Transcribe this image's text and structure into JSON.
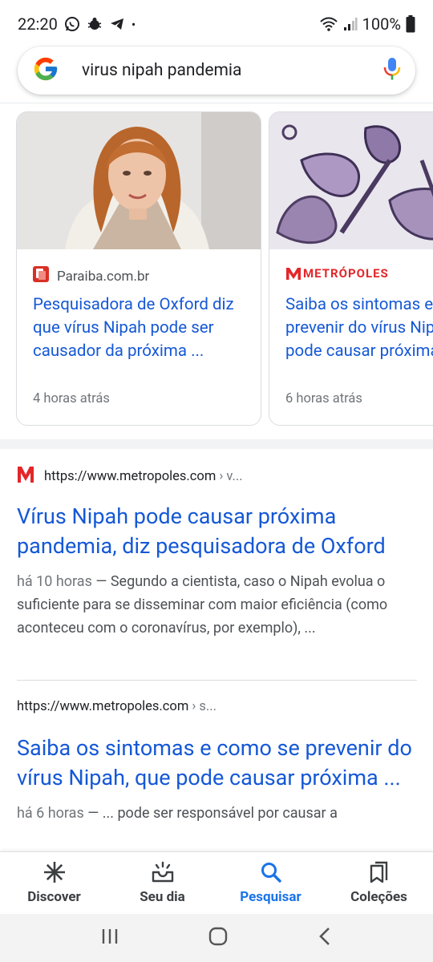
{
  "status_bar": {
    "time": "22:20",
    "dot": "•",
    "battery": "100%"
  },
  "search": {
    "query": "virus nipah pandemia"
  },
  "top_stories": [
    {
      "source": "Paraiba.com.br",
      "title": "Pesquisadora de Oxford diz que vírus Nipah pode ser causador da próxima ...",
      "time": "4 horas atrás"
    },
    {
      "source_logo_text": "METRÓPOLES",
      "title": "Saiba os sintomas e como se prevenir do vírus Nipah, que pode causar próxima...",
      "time": "6 horas atrás"
    }
  ],
  "results": [
    {
      "url": "https://www.metropoles.com",
      "crumb": "› v...",
      "title": "Vírus Nipah pode causar próxima pandemia, diz pesquisadora de Oxford",
      "date": "há 10 horas",
      "snippet": " — Segundo a cientista, caso o Nipah evolua o suficiente para se disseminar com maior eficiência (como aconteceu com o coronavírus, por exemplo), ..."
    },
    {
      "url": "https://www.metropoles.com",
      "crumb": "› s...",
      "title": "Saiba os sintomas e como se prevenir do vírus Nipah, que pode causar próxima ...",
      "date": "há 6 horas",
      "snippet": " — ... pode ser responsável por causar a"
    }
  ],
  "bottom_nav": {
    "discover": "Discover",
    "seu_dia": "Seu dia",
    "pesquisar": "Pesquisar",
    "colecoes": "Coleções"
  },
  "colors": {
    "link": "#1558d6",
    "active_tab": "#1a73e8",
    "metropoles_red": "#e3262a"
  }
}
